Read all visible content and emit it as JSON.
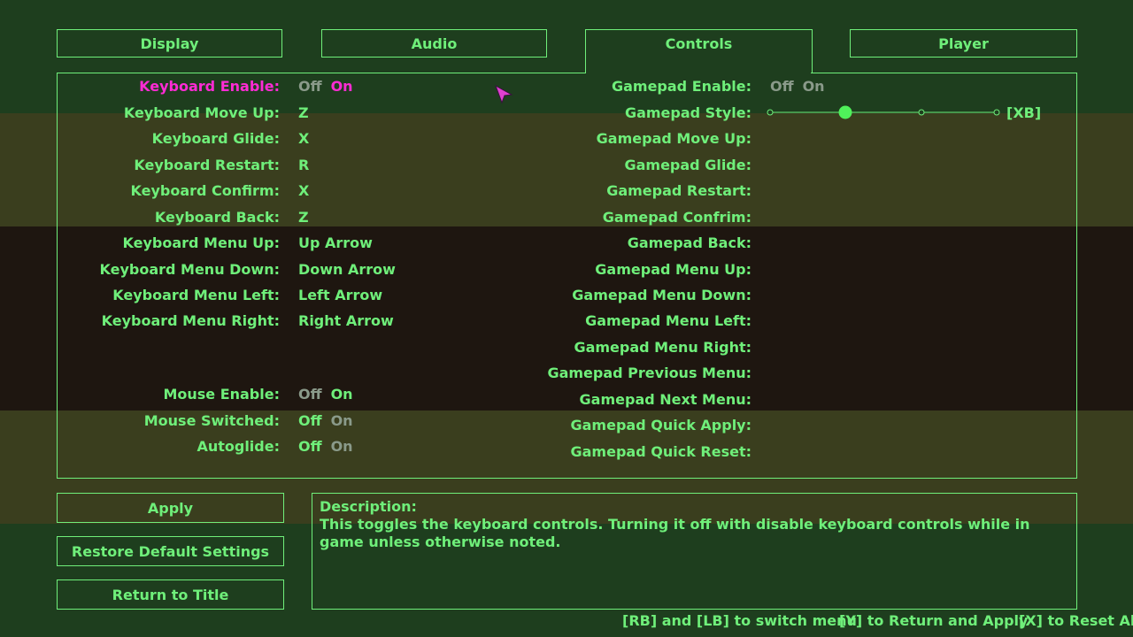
{
  "tabs": [
    {
      "label": "Display"
    },
    {
      "label": "Audio"
    },
    {
      "label": "Controls"
    },
    {
      "label": "Player"
    }
  ],
  "keyboard": {
    "enable": {
      "label": "Keyboard Enable:",
      "off": "Off",
      "on": "On"
    },
    "bindings": [
      {
        "label": "Keyboard Move Up:",
        "value": "Z"
      },
      {
        "label": "Keyboard Glide:",
        "value": "X"
      },
      {
        "label": "Keyboard Restart:",
        "value": "R"
      },
      {
        "label": "Keyboard Confirm:",
        "value": "X"
      },
      {
        "label": "Keyboard Back:",
        "value": "Z"
      },
      {
        "label": "Keyboard Menu Up:",
        "value": "Up Arrow"
      },
      {
        "label": "Keyboard Menu Down:",
        "value": "Down Arrow"
      },
      {
        "label": "Keyboard Menu Left:",
        "value": "Left Arrow"
      },
      {
        "label": "Keyboard Menu Right:",
        "value": "Right Arrow"
      }
    ]
  },
  "mouse": {
    "enable": {
      "label": "Mouse Enable:",
      "off": "Off",
      "on": "On"
    },
    "switched": {
      "label": "Mouse Switched:",
      "off": "Off",
      "on": "On"
    },
    "autoglide": {
      "label": "Autoglide:",
      "off": "Off",
      "on": "On"
    }
  },
  "gamepad": {
    "enable": {
      "label": "Gamepad Enable:",
      "off": "Off",
      "on": "On"
    },
    "style": {
      "label": "Gamepad Style:",
      "value": "[XB]",
      "selected_index": 1,
      "options_count": 4
    },
    "bindings": [
      {
        "label": "Gamepad Move Up:"
      },
      {
        "label": "Gamepad Glide:"
      },
      {
        "label": "Gamepad Restart:"
      },
      {
        "label": "Gamepad Confrim:"
      },
      {
        "label": "Gamepad Back:"
      },
      {
        "label": "Gamepad Menu Up:"
      },
      {
        "label": "Gamepad Menu Down:"
      },
      {
        "label": "Gamepad Menu Left:"
      },
      {
        "label": "Gamepad Menu Right:"
      },
      {
        "label": "Gamepad Previous Menu:"
      },
      {
        "label": "Gamepad Next Menu:"
      },
      {
        "label": "Gamepad Quick Apply:"
      },
      {
        "label": "Gamepad Quick Reset:"
      }
    ]
  },
  "buttons": {
    "apply": "Apply",
    "restore": "Restore Default Settings",
    "return": "Return to Title"
  },
  "description": {
    "heading": "Description:",
    "text": "This toggles the keyboard controls. Turning it off with disable keyboard controls while in game unless otherwise noted."
  },
  "hints": {
    "switch": "[RB] and [LB] to switch menu",
    "return_apply": "[Y] to Return and Apply",
    "reset": "[X] to Reset All."
  },
  "colors": {
    "text": "#6fef7a",
    "highlight": "#ff2bd5",
    "dim": "#8a9a8a"
  }
}
